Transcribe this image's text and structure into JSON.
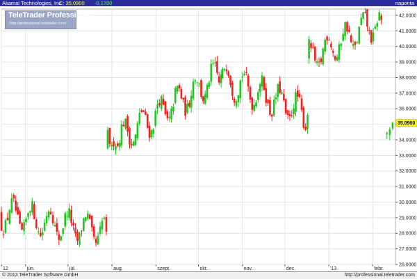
{
  "header": {
    "company": "Akamai Technologies, Inc.",
    "close_label": "C: 35.0900",
    "change_label": "-0.1700",
    "period": "napontа"
  },
  "logo": {
    "name": "TeleTrader Professional",
    "url": "http://professional.teletrader.com/"
  },
  "footer": {
    "copyright": "© 2013 TeleTrader Software GmbH",
    "url": "http://professional.teletrader.com"
  },
  "colors": {
    "up": "#22c422",
    "down": "#ff1a1a",
    "title_bar": "#2a2c9c",
    "grid": "#e2e2e2",
    "last_price_marker": "#ffff00"
  },
  "chart_data": {
    "type": "candlestick",
    "title": "Akamai Technologies, Inc.",
    "last_price": 35.09,
    "change": -0.17,
    "ylim": [
      26,
      42.4
    ],
    "y_ticks": [
      "26.0000",
      "27.0000",
      "28.0000",
      "29.0000",
      "30.0000",
      "31.0000",
      "32.0000",
      "33.0000",
      "34.0000",
      "35.0000",
      "36.0000",
      "37.0000",
      "38.0000",
      "39.0000",
      "40.0000",
      "41.0000",
      "42.0000"
    ],
    "x_labels": [
      {
        "label": "12",
        "day": 0
      },
      {
        "label": "jún.",
        "day": 17
      },
      {
        "label": "júl.",
        "day": 47
      },
      {
        "label": "aug.",
        "day": 78
      },
      {
        "label": "szept.",
        "day": 109
      },
      {
        "label": "okt.",
        "day": 139
      },
      {
        "label": "nov.",
        "day": 170
      },
      {
        "label": "dec.",
        "day": 200
      },
      {
        "label": "'13",
        "day": 231
      },
      {
        "label": "febr.",
        "day": 262
      }
    ],
    "x_range": [
      0,
      278
    ],
    "segments": [
      {
        "start_day": 0,
        "end_day": 74,
        "start": 29.2,
        "end": 28.1,
        "count": 52,
        "range": [
          26.8,
          32.2
        ]
      },
      {
        "start_day": 75,
        "end_day": 155,
        "start": 33.6,
        "end": 38.2,
        "count": 58,
        "range": [
          33.6,
          40.8
        ]
      },
      {
        "start_day": 156,
        "end_day": 216,
        "start": 38.0,
        "end": 35.6,
        "count": 44,
        "range": [
          34.4,
          39.6
        ]
      },
      {
        "start_day": 217,
        "end_day": 268,
        "start": 39.2,
        "end": 41.7,
        "count": 37,
        "range": [
          39.0,
          42.2
        ]
      },
      {
        "start_day": 272,
        "end_day": 276,
        "start": 34.2,
        "end": 35.09,
        "count": 3,
        "range": [
          33.8,
          35.6
        ]
      }
    ]
  }
}
